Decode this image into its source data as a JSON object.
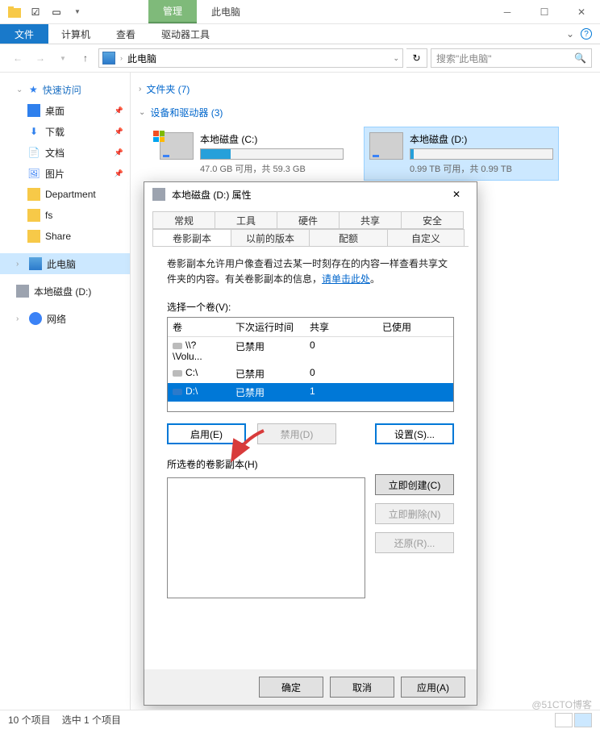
{
  "titlebar": {
    "contextual_tab": "管理",
    "context_label": "此电脑"
  },
  "ribbon": {
    "file": "文件",
    "tabs": [
      "计算机",
      "查看",
      "驱动器工具"
    ]
  },
  "nav": {
    "location": "此电脑",
    "search_placeholder": "搜索\"此电脑\""
  },
  "sidebar": {
    "quick_access": "快速访问",
    "items": [
      {
        "label": "桌面",
        "cls": "ico-desktop"
      },
      {
        "label": "下载",
        "cls": "ico-down"
      },
      {
        "label": "文档",
        "cls": "ico-doc"
      },
      {
        "label": "图片",
        "cls": "ico-pic"
      },
      {
        "label": "Department",
        "cls": "ico-folder"
      },
      {
        "label": "fs",
        "cls": "ico-folder"
      },
      {
        "label": "Share",
        "cls": "ico-folder"
      }
    ],
    "this_pc": "此电脑",
    "local_disk": "本地磁盘 (D:)",
    "network": "网络"
  },
  "sections": {
    "folders": "文件夹 (7)",
    "devices": "设备和驱动器 (3)"
  },
  "drives": [
    {
      "name": "本地磁盘 (C:)",
      "sub": "47.0 GB 可用，共 59.3 GB",
      "fill": 21,
      "selected": false,
      "win": true
    },
    {
      "name": "本地磁盘 (D:)",
      "sub": "0.99 TB 可用，共 0.99 TB",
      "fill": 2,
      "selected": true,
      "win": false
    }
  ],
  "dialog": {
    "title": "本地磁盘 (D:) 属性",
    "tabs_row1": [
      "常规",
      "工具",
      "硬件",
      "共享",
      "安全"
    ],
    "tabs_row2": [
      "卷影副本",
      "以前的版本",
      "配额",
      "自定义"
    ],
    "active_tab": "卷影副本",
    "desc": "卷影副本允许用户像查看过去某一时刻存在的内容一样查看共享文件夹的内容。有关卷影副本的信息，",
    "link": "请单击此处",
    "select_vol": "选择一个卷(V):",
    "headers": {
      "c1": "卷",
      "c2": "下次运行时间",
      "c3": "共享",
      "c4": "已使用"
    },
    "rows": [
      {
        "vol": "\\\\?\\Volu...",
        "next": "已禁用",
        "share": "0",
        "used": "",
        "sel": false
      },
      {
        "vol": "C:\\",
        "next": "已禁用",
        "share": "0",
        "used": "",
        "sel": false
      },
      {
        "vol": "D:\\",
        "next": "已禁用",
        "share": "1",
        "used": "",
        "sel": true
      }
    ],
    "btn_enable": "启用(E)",
    "btn_disable": "禁用(D)",
    "btn_settings": "设置(S)...",
    "selected_copies": "所选卷的卷影副本(H)",
    "btn_create": "立即创建(C)",
    "btn_delete": "立即删除(N)",
    "btn_restore": "还原(R)...",
    "btn_ok": "确定",
    "btn_cancel": "取消",
    "btn_apply": "应用(A)"
  },
  "status": {
    "items": "10 个项目",
    "selected": "选中 1 个项目"
  },
  "watermark": "@51CTO博客"
}
